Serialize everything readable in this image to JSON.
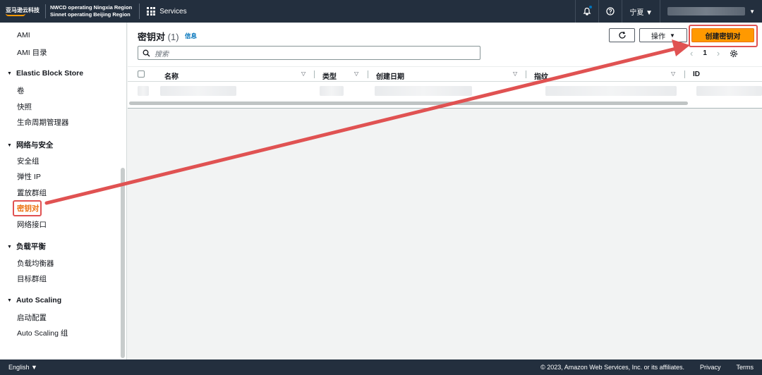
{
  "topbar": {
    "logo_text": "亚马逊云科技",
    "region_line1": "NWCD operating Ningxia Region",
    "region_line2": "Sinnet operating Beijing Region",
    "services_label": "Services",
    "region_selector": "宁夏 ▼",
    "account_caret": "▼"
  },
  "sidebar": {
    "items": [
      {
        "label": "AMI"
      },
      {
        "label": "AMI 目录"
      },
      {
        "label": "Elastic Block Store",
        "heading": true
      },
      {
        "label": "卷"
      },
      {
        "label": "快照"
      },
      {
        "label": "生命周期管理器"
      },
      {
        "label": "网络与安全",
        "heading": true
      },
      {
        "label": "安全组"
      },
      {
        "label": "弹性 IP"
      },
      {
        "label": "置放群组"
      },
      {
        "label": "密钥对",
        "active": true
      },
      {
        "label": "网络接口"
      },
      {
        "label": "负载平衡",
        "heading": true
      },
      {
        "label": "负载均衡器"
      },
      {
        "label": "目标群组"
      },
      {
        "label": "Auto Scaling",
        "heading": true
      },
      {
        "label": "启动配置"
      },
      {
        "label": "Auto Scaling 组"
      }
    ]
  },
  "main": {
    "title": "密钥对",
    "count": "(1)",
    "info_link": "信息",
    "refresh_icon": "refresh-icon",
    "actions_label": "操作",
    "create_label": "创建密钥对",
    "search_placeholder": "搜索",
    "page_number": "1",
    "columns": [
      "名称",
      "类型",
      "创建日期",
      "指纹",
      "ID"
    ]
  },
  "footer": {
    "language": "English ▼",
    "copyright": "© 2023, Amazon Web Services, Inc. or its affiliates.",
    "privacy": "Privacy",
    "terms": "Terms"
  },
  "colors": {
    "topbar": "#232f3e",
    "accent": "#ff9900",
    "active_nav": "#ec7211",
    "annotation": "#e05252",
    "link": "#0073bb"
  }
}
